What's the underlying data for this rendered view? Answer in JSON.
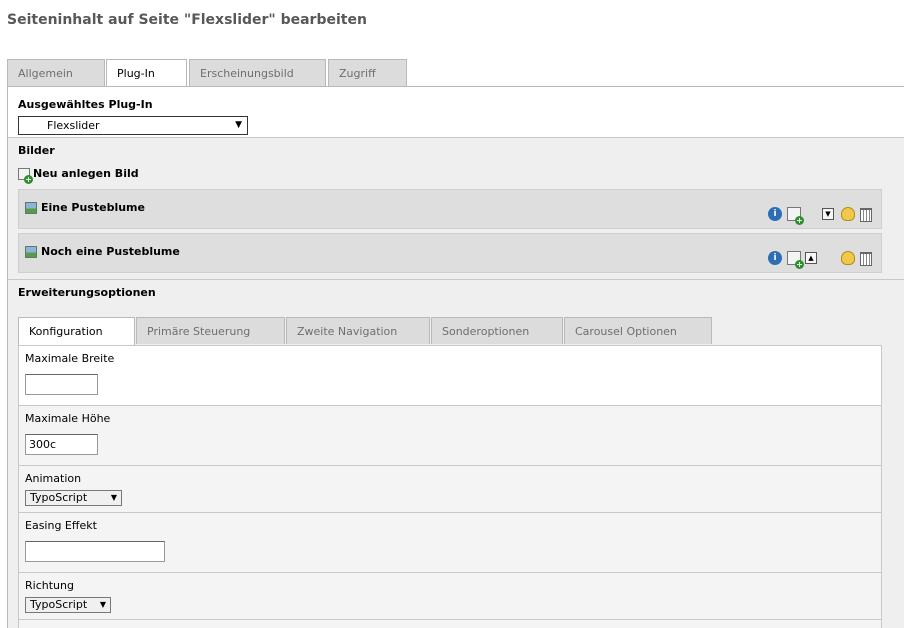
{
  "page_title": "Seiteninhalt auf Seite \"Flexslider\" bearbeiten",
  "main_tabs": [
    "Allgemein",
    "Plug-In",
    "Erscheinungsbild",
    "Zugriff"
  ],
  "plugin": {
    "label": "Ausgewähltes Plug-In",
    "selected": "Flexslider",
    "arrow": "▼"
  },
  "images": {
    "heading": "Bilder",
    "new_label": "Neu anlegen Bild",
    "records": [
      {
        "title": "Eine Pusteblume",
        "move": "▼"
      },
      {
        "title": "Noch eine Pusteblume",
        "move": "▲"
      }
    ]
  },
  "extension": {
    "heading": "Erweiterungsoptionen",
    "tabs": [
      "Konfiguration",
      "Primäre Steuerung",
      "Zweite Navigation",
      "Sonderoptionen",
      "Carousel Optionen"
    ],
    "fields": {
      "max_width": {
        "label": "Maximale Breite",
        "value": ""
      },
      "max_height": {
        "label": "Maximale Höhe",
        "value": "300c"
      },
      "animation": {
        "label": "Animation",
        "value": "TypoScript",
        "arrow": "▼"
      },
      "easing": {
        "label": "Easing Effekt",
        "value": ""
      },
      "direction": {
        "label": "Richtung",
        "value": "TypoScript",
        "arrow": "▼"
      }
    }
  },
  "colors": {
    "active_tab_bg": "#ffffff",
    "inactive_tab_bg": "#dcdcdc",
    "record_bg": "#dedede",
    "info_icon": "#2d6db5"
  }
}
